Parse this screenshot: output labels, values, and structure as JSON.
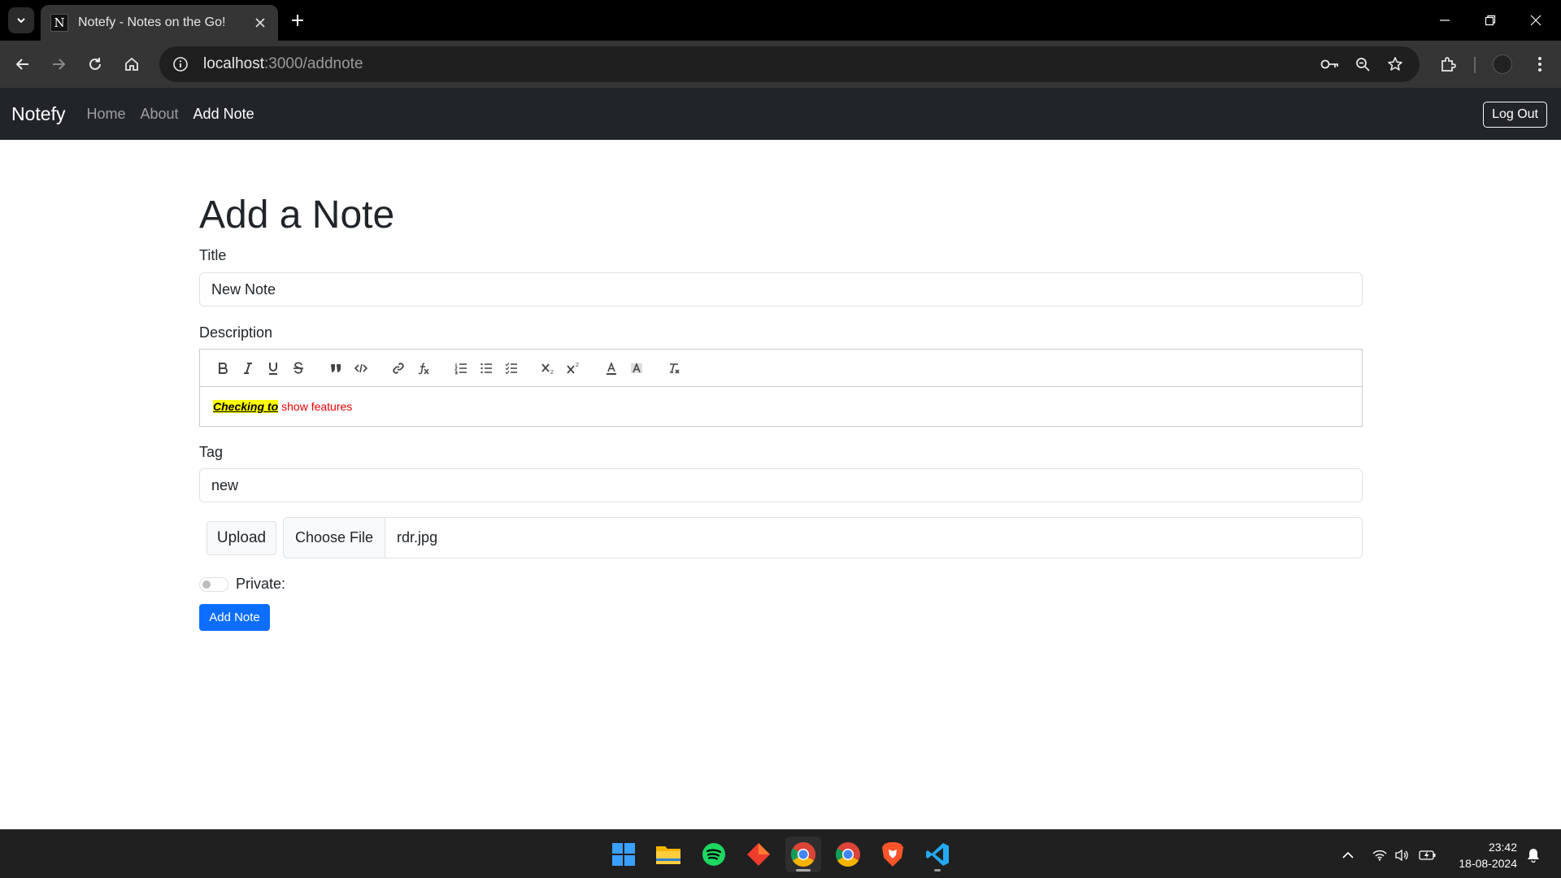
{
  "browser": {
    "tab_title": "Notefy - Notes on the Go!",
    "favicon_letter": "N",
    "url_host": "localhost",
    "url_path": ":3000/addnote"
  },
  "navbar": {
    "brand": "Notefy",
    "links": [
      {
        "label": "Home",
        "active": false
      },
      {
        "label": "About",
        "active": false
      },
      {
        "label": "Add Note",
        "active": true
      }
    ],
    "logout_label": "Log Out"
  },
  "page": {
    "heading": "Add a Note",
    "title_label": "Title",
    "title_value": "New Note",
    "description_label": "Description",
    "editor_content": {
      "highlighted": "Checking to",
      "rest": "show features"
    },
    "tag_label": "Tag",
    "tag_value": "new",
    "upload_label": "Upload",
    "choose_file_label": "Choose File",
    "file_name": "rdr.jpg",
    "private_label": "Private:",
    "private_checked": false,
    "submit_label": "Add Note"
  },
  "taskbar": {
    "time": "23:42",
    "date": "18-08-2024",
    "apps": [
      "start-icon",
      "file-explorer-icon",
      "spotify-icon",
      "git-icon",
      "chrome-icon",
      "chrome-icon",
      "brave-icon",
      "vscode-icon"
    ]
  },
  "colors": {
    "navbar_bg": "#212529",
    "primary": "#0d6efd",
    "highlight": "#ffff00",
    "editor_red": "#e60000"
  }
}
